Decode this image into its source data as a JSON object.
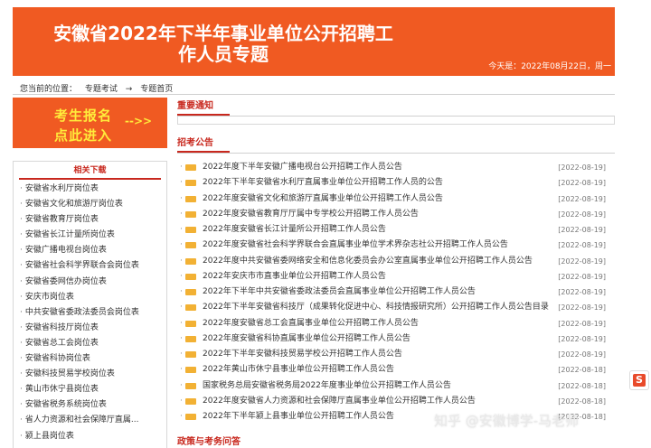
{
  "banner": {
    "title_line1": "安徽省2022年下半年事业单位公开招聘工",
    "title_line2": "作人员专题",
    "date_text": "今天是：2022年08月22日，周一"
  },
  "breadcrumb": {
    "prefix": "您当前的位置：",
    "item1": "专题考试",
    "sep": "→",
    "item2": "专题首页"
  },
  "signup": {
    "line1": "考生报名",
    "line2": "点此进入",
    "arrow": "-->>"
  },
  "downloads": {
    "title": "相关下载",
    "items": [
      "安徽省水利厅岗位表",
      "安徽省文化和旅游厅岗位表",
      "安徽省教育厅岗位表",
      "安徽省长江计量所岗位表",
      "安徽广播电视台岗位表",
      "安徽省社会科学界联合会岗位表",
      "安徽省委网信办岗位表",
      "安庆市岗位表",
      "中共安徽省委政法委员会岗位表",
      "安徽省科技厅岗位表",
      "安徽省总工会岗位表",
      "安徽省科协岗位表",
      "安徽科技贸易学校岗位表",
      "黄山市休宁县岗位表",
      "安徽省税务系统岗位表",
      "省人力资源和社会保障厅直属...",
      "颍上县岗位表"
    ]
  },
  "sections": {
    "notice": "重要通知",
    "recruit": "招考公告",
    "policy": "政策与考务问答"
  },
  "announcements": [
    {
      "title": "2022年度下半年安徽广播电视台公开招聘工作人员公告",
      "date": "[2022-08-19]"
    },
    {
      "title": "2022年下半年安徽省水利厅直属事业单位公开招聘工作人员的公告",
      "date": "[2022-08-19]"
    },
    {
      "title": "2022年度安徽省文化和旅游厅直属事业单位公开招聘工作人员公告",
      "date": "[2022-08-19]"
    },
    {
      "title": "2022年度安徽省教育厅厅属中专学校公开招聘工作人员公告",
      "date": "[2022-08-19]"
    },
    {
      "title": "2022年度安徽省长江计量所公开招聘工作人员公告",
      "date": "[2022-08-19]"
    },
    {
      "title": "2022年度安徽省社会科学界联合会直属事业单位学术界杂志社公开招聘工作人员公告",
      "date": "[2022-08-19]"
    },
    {
      "title": "2022年度中共安徽省委网络安全和信息化委员会办公室直属事业单位公开招聘工作人员公告",
      "date": "[2022-08-19]"
    },
    {
      "title": "2022年安庆市市直事业单位公开招聘工作人员公告",
      "date": "[2022-08-19]"
    },
    {
      "title": "2022年下半年中共安徽省委政法委员会直属事业单位公开招聘工作人员公告",
      "date": "[2022-08-19]"
    },
    {
      "title": "2022年下半年安徽省科技厅（成果转化促进中心、科技情报研究所）公开招聘工作人员公告目录",
      "date": "[2022-08-19]"
    },
    {
      "title": "2022年度安徽省总工会直属事业单位公开招聘工作人员公告",
      "date": "[2022-08-19]"
    },
    {
      "title": "2022年度安徽省科协直属事业单位公开招聘工作人员公告",
      "date": "[2022-08-19]"
    },
    {
      "title": "2022年下半年安徽科技贸易学校公开招聘工作人员公告",
      "date": "[2022-08-19]"
    },
    {
      "title": "2022年黄山市休宁县事业单位公开招聘工作人员公告",
      "date": "[2022-08-18]"
    },
    {
      "title": "国家税务总局安徽省税务局2022年度事业单位公开招聘工作人员公告",
      "date": "[2022-08-18]"
    },
    {
      "title": "2022年度安徽省人力资源和社会保障厅直属事业单位公开招聘工作人员公告",
      "date": "[2022-08-18]"
    },
    {
      "title": "2022年下半年颍上县事业单位公开招聘工作人员公告",
      "date": "[2022-08-18]"
    }
  ],
  "watermark": "知乎 @安徽博学-马老师",
  "widget_letter": "S"
}
